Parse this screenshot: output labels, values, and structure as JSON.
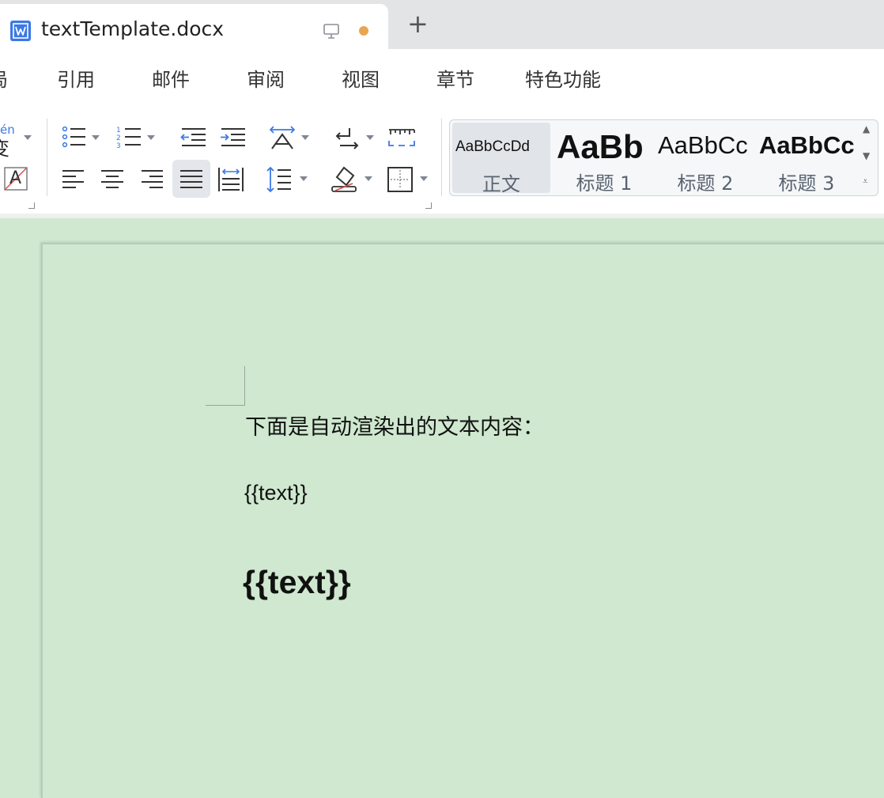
{
  "tab": {
    "title": "textTemplate.docx",
    "doc_icon": "wps-writer-icon",
    "monitor_icon": "monitor-icon",
    "unsaved_dot_color": "#e8a653",
    "new_tab_label": "+"
  },
  "menu": {
    "items": [
      "局",
      "引用",
      "邮件",
      "审阅",
      "视图",
      "章节",
      "特色功能"
    ]
  },
  "ribbon": {
    "pinyin_label": "én",
    "pinyin_glyph": "变",
    "clear_format_glyph": "A",
    "styles": [
      {
        "sample": "AaBbCcDd",
        "label": "正文",
        "selected": true
      },
      {
        "sample": "AaBb",
        "label": "标题 1",
        "selected": false
      },
      {
        "sample": "AaBbCc",
        "label": "标题 2",
        "selected": false
      },
      {
        "sample": "AaBbCc",
        "label": "标题 3",
        "selected": false
      }
    ]
  },
  "document": {
    "paragraph1": "下面是自动渲染出的文本内容：",
    "paragraph2": "{{text}}",
    "paragraph3": "{{text}}",
    "background_color": "#cfe8cf"
  }
}
